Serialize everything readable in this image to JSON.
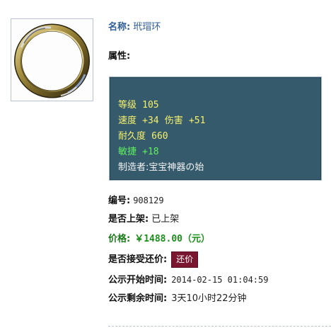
{
  "item": {
    "name_label": "名称:",
    "name_value": "玳瑁环",
    "attributes_label": "属性:",
    "icon": "ring-icon"
  },
  "attributes": {
    "level_label": "等级",
    "level_value": "105",
    "speed_label": "速度",
    "speed_value": "+34",
    "damage_label": "伤害",
    "damage_value": "+51",
    "durability_label": "耐久度",
    "durability_value": "660",
    "agility_label": "敏捷",
    "agility_value": "+18",
    "maker_label": "制造者:",
    "maker_value": "宝宝神器の始"
  },
  "details": {
    "serial_label": "编号:",
    "serial_value": "908129",
    "listed_label": "是否上架:",
    "listed_value": "已上架",
    "price_label": "价格:",
    "price_value": "￥1488.00（元）",
    "counter_label": "是否接受还价:",
    "counter_button": "还价",
    "start_label": "公示开始时间:",
    "start_value": "2014-02-15 01:04:59",
    "remaining_label": "公示剩余时间:",
    "remaining_value": "3天10小时22分钟"
  },
  "colors": {
    "attr_background": "#355a6b",
    "attr_yellow": "#f7f06c",
    "attr_green": "#5ff05f",
    "price_green": "#1a8f1a",
    "button": "#7b1631",
    "name_blue": "#2f5d97"
  }
}
